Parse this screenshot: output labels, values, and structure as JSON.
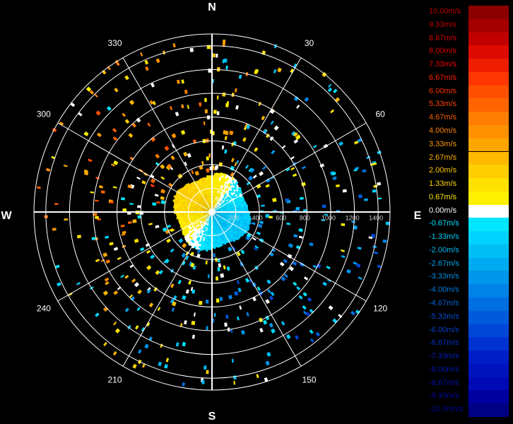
{
  "chart_data": {
    "type": "polar-radar",
    "cardinals": {
      "north": "N",
      "east": "E",
      "south": "S",
      "west": "W"
    },
    "azimuth_labels": [
      {
        "deg": 30,
        "text": "30"
      },
      {
        "deg": 60,
        "text": "60"
      },
      {
        "deg": 120,
        "text": "120"
      },
      {
        "deg": 150,
        "text": "150"
      },
      {
        "deg": 210,
        "text": "210"
      },
      {
        "deg": 240,
        "text": "240"
      },
      {
        "deg": 300,
        "text": "300"
      },
      {
        "deg": 330,
        "text": "330"
      }
    ],
    "range_labels": [
      "200",
      "400",
      "600",
      "800",
      "1000",
      "1200",
      "1400"
    ],
    "range_ticks": [
      200,
      400,
      600,
      800,
      1000,
      1200,
      1400
    ],
    "rings": [
      200,
      400,
      600,
      800,
      1000,
      1200,
      1400
    ],
    "max_range": 1500,
    "grid": true,
    "legend": {
      "placement": "right",
      "entries": [
        {
          "label": "10.00m/s",
          "color": "#8b0000",
          "text": "#c00000"
        },
        {
          "label": "9.33m/s",
          "color": "#a50000",
          "text": "#c00000"
        },
        {
          "label": "8.67m/s",
          "color": "#c00000",
          "text": "#d00000"
        },
        {
          "label": "8.00m/s",
          "color": "#dc0a00",
          "text": "#e00000"
        },
        {
          "label": "7.33m/s",
          "color": "#f01e00",
          "text": "#f00000"
        },
        {
          "label": "6.67m/s",
          "color": "#ff3700",
          "text": "#ff2000"
        },
        {
          "label": "6.00m/s",
          "color": "#ff5000",
          "text": "#ff3000"
        },
        {
          "label": "5.33m/s",
          "color": "#ff6400",
          "text": "#ff4500"
        },
        {
          "label": "4.67m/s",
          "color": "#ff7d00",
          "text": "#ff6000"
        },
        {
          "label": "4.00m/s",
          "color": "#ff9100",
          "text": "#ff8000"
        },
        {
          "label": "3.33m/s",
          "color": "#ffa500",
          "text": "#ff9a00"
        },
        {
          "label": "2.67m/s",
          "color": "#ffb900",
          "text": "#ffb000"
        },
        {
          "label": "2.00m/s",
          "color": "#ffcd00",
          "text": "#ffc800"
        },
        {
          "label": "1.33m/s",
          "color": "#ffe100",
          "text": "#ffd800"
        },
        {
          "label": "0.67m/s",
          "color": "#fff000",
          "text": "#ffe800"
        },
        {
          "label": "0.00m/s",
          "color": "#ffffff",
          "text": "#ffffff"
        },
        {
          "label": "-0.67m/s",
          "color": "#00e6ff",
          "text": "#00e0ff"
        },
        {
          "label": "-1.33m/s",
          "color": "#00d2ff",
          "text": "#00d0ff"
        },
        {
          "label": "-2.00m/s",
          "color": "#00bef5",
          "text": "#00b8f0"
        },
        {
          "label": "-2.67m/s",
          "color": "#00aaf0",
          "text": "#00a8f0"
        },
        {
          "label": "-3.33m/s",
          "color": "#0096eb",
          "text": "#0090e8"
        },
        {
          "label": "-4.00m/s",
          "color": "#0082e6",
          "text": "#0078e0"
        },
        {
          "label": "-4.67m/s",
          "color": "#006ee1",
          "text": "#0064d8"
        },
        {
          "label": "-5.33m/s",
          "color": "#005adc",
          "text": "#0050d0"
        },
        {
          "label": "-6.00m/s",
          "color": "#0046d7",
          "text": "#0040c8"
        },
        {
          "label": "-6.67m/s",
          "color": "#0032d2",
          "text": "#0030c0"
        },
        {
          "label": "-7.33m/s",
          "color": "#001ec8",
          "text": "#0020b8"
        },
        {
          "label": "-8.00m/s",
          "color": "#0014be",
          "text": "#0018b0"
        },
        {
          "label": "-8.67m/s",
          "color": "#000ab4",
          "text": "#0010a8"
        },
        {
          "label": "-9.33m/s",
          "color": "#0000a0",
          "text": "#0008a0"
        },
        {
          "label": "-10.00m/s",
          "color": "#000082",
          "text": "#000898"
        }
      ]
    },
    "colors": {
      "background": "#000000",
      "grid": "#ffffff"
    }
  }
}
